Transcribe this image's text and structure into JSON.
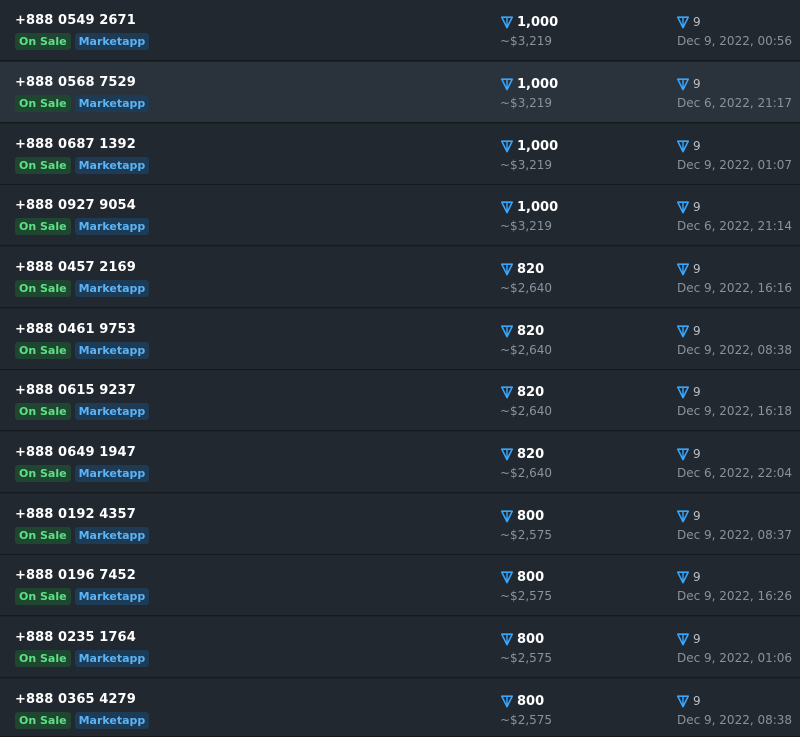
{
  "currency_icon": "ton-diamond-icon",
  "colors": {
    "background": "#1e2329",
    "row": "#212830",
    "row_highlight": "#2a323c",
    "on_sale": "#5de283",
    "marketplace": "#5cb3f5",
    "ton": "#37a7ff"
  },
  "rows": [
    {
      "number": "+888 0549 2671",
      "status": "On Sale",
      "market": "Marketapp",
      "price": "1,000",
      "usd": "~$3,219",
      "bid": "9",
      "date": "Dec 9, 2022, 00:56"
    },
    {
      "number": "+888 0568 7529",
      "status": "On Sale",
      "market": "Marketapp",
      "price": "1,000",
      "usd": "~$3,219",
      "bid": "9",
      "date": "Dec 6, 2022, 21:17"
    },
    {
      "number": "+888 0687 1392",
      "status": "On Sale",
      "market": "Marketapp",
      "price": "1,000",
      "usd": "~$3,219",
      "bid": "9",
      "date": "Dec 9, 2022, 01:07"
    },
    {
      "number": "+888 0927 9054",
      "status": "On Sale",
      "market": "Marketapp",
      "price": "1,000",
      "usd": "~$3,219",
      "bid": "9",
      "date": "Dec 6, 2022, 21:14"
    },
    {
      "number": "+888 0457 2169",
      "status": "On Sale",
      "market": "Marketapp",
      "price": "820",
      "usd": "~$2,640",
      "bid": "9",
      "date": "Dec 9, 2022, 16:16"
    },
    {
      "number": "+888 0461 9753",
      "status": "On Sale",
      "market": "Marketapp",
      "price": "820",
      "usd": "~$2,640",
      "bid": "9",
      "date": "Dec 9, 2022, 08:38"
    },
    {
      "number": "+888 0615 9237",
      "status": "On Sale",
      "market": "Marketapp",
      "price": "820",
      "usd": "~$2,640",
      "bid": "9",
      "date": "Dec 9, 2022, 16:18"
    },
    {
      "number": "+888 0649 1947",
      "status": "On Sale",
      "market": "Marketapp",
      "price": "820",
      "usd": "~$2,640",
      "bid": "9",
      "date": "Dec 6, 2022, 22:04"
    },
    {
      "number": "+888 0192 4357",
      "status": "On Sale",
      "market": "Marketapp",
      "price": "800",
      "usd": "~$2,575",
      "bid": "9",
      "date": "Dec 9, 2022, 08:37"
    },
    {
      "number": "+888 0196 7452",
      "status": "On Sale",
      "market": "Marketapp",
      "price": "800",
      "usd": "~$2,575",
      "bid": "9",
      "date": "Dec 9, 2022, 16:26"
    },
    {
      "number": "+888 0235 1764",
      "status": "On Sale",
      "market": "Marketapp",
      "price": "800",
      "usd": "~$2,575",
      "bid": "9",
      "date": "Dec 9, 2022, 01:06"
    },
    {
      "number": "+888 0365 4279",
      "status": "On Sale",
      "market": "Marketapp",
      "price": "800",
      "usd": "~$2,575",
      "bid": "9",
      "date": "Dec 9, 2022, 08:38"
    }
  ]
}
